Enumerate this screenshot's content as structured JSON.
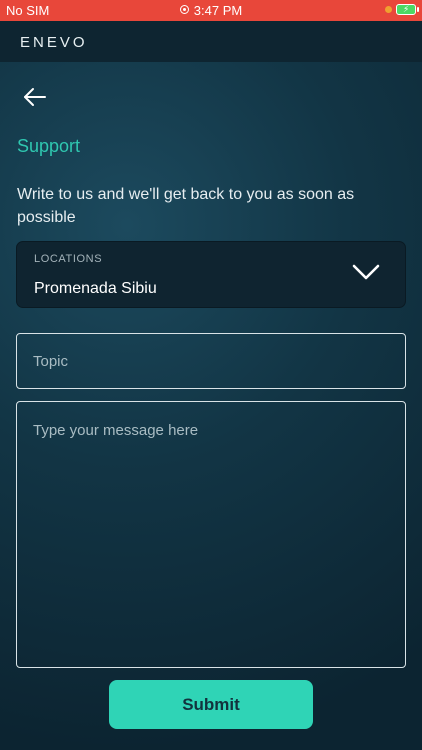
{
  "statusbar": {
    "carrier": "No SIM",
    "time": "3:47 PM"
  },
  "app": {
    "logo": "ENEVO"
  },
  "page": {
    "title": "Support",
    "subtitle": "Write to us and we'll get back to you as soon as possible"
  },
  "location": {
    "label": "LOCATIONS",
    "value": "Promenada Sibiu"
  },
  "form": {
    "topic_placeholder": "Topic",
    "message_placeholder": "Type your message here",
    "submit_label": "Submit"
  },
  "colors": {
    "accent": "#2fd4b6",
    "statusbar": "#e8473a",
    "title": "#2fc7b0"
  }
}
